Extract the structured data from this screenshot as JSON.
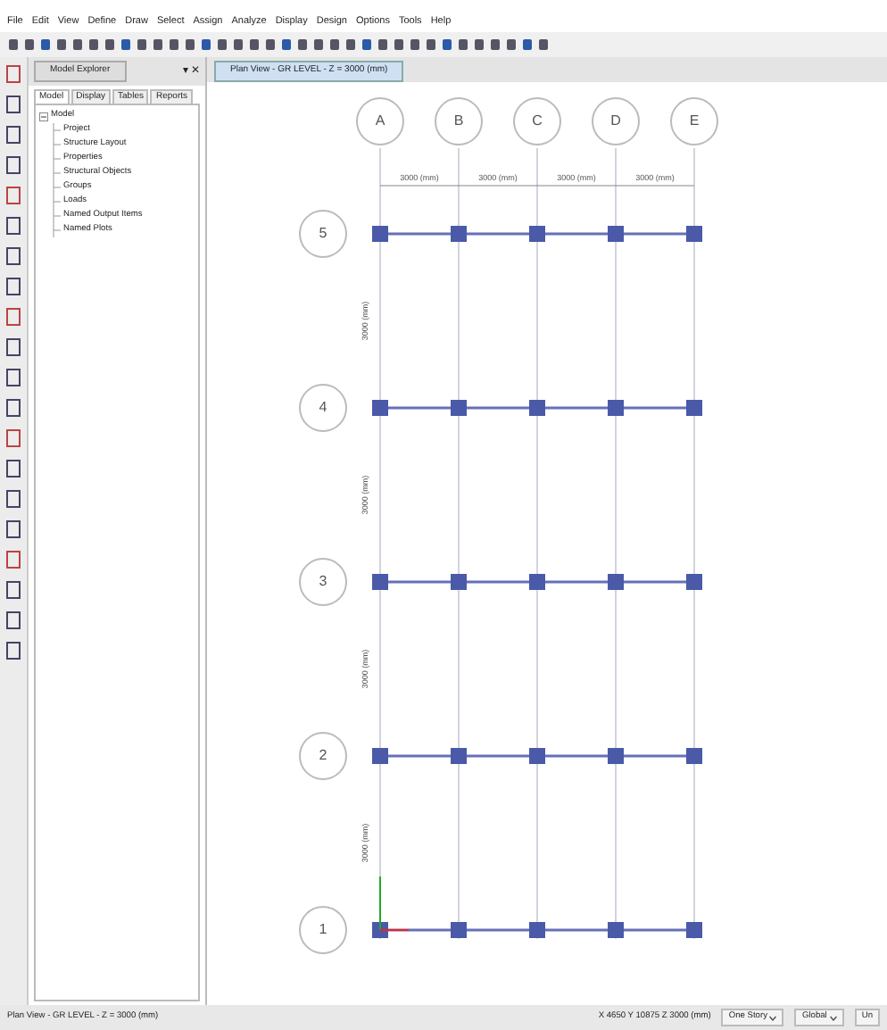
{
  "menu": [
    "File",
    "Edit",
    "View",
    "Define",
    "Draw",
    "Select",
    "Assign",
    "Analyze",
    "Display",
    "Design",
    "Options",
    "Tools",
    "Help"
  ],
  "explorer": {
    "title": "Model Explorer",
    "pin": "▾ ✕",
    "tabs": [
      {
        "label": "Model",
        "selected": true
      },
      {
        "label": "Display",
        "selected": false
      },
      {
        "label": "Tables",
        "selected": false
      },
      {
        "label": "Reports",
        "selected": false
      }
    ],
    "tree": [
      {
        "label": "Model",
        "expanded": true,
        "children": [
          {
            "label": "Project"
          },
          {
            "label": "Structure Layout"
          },
          {
            "label": "Properties"
          },
          {
            "label": "Structural Objects"
          },
          {
            "label": "Groups"
          },
          {
            "label": "Loads"
          },
          {
            "label": "Named Output Items"
          },
          {
            "label": "Named Plots"
          }
        ]
      }
    ]
  },
  "view": {
    "title": "Plan View - GR LEVEL - Z = 3000 (mm)",
    "grid": {
      "columns": [
        "A",
        "B",
        "C",
        "D",
        "E"
      ],
      "rows": [
        "5",
        "4",
        "3",
        "2",
        "1"
      ],
      "x_dimensions": [
        "3000 (mm)",
        "3000 (mm)",
        "3000 (mm)",
        "3000 (mm)"
      ],
      "y_dimensions": [
        "3000 (mm)",
        "3000 (mm)",
        "3000 (mm)",
        "3000 (mm)"
      ]
    }
  },
  "status_bar": {
    "view": "Plan View - GR LEVEL - Z = 3000 (mm)",
    "coordinates": "X 4650  Y 10875  Z 3000 (mm)",
    "story": "One Story",
    "system": "Global",
    "units": "Un"
  }
}
